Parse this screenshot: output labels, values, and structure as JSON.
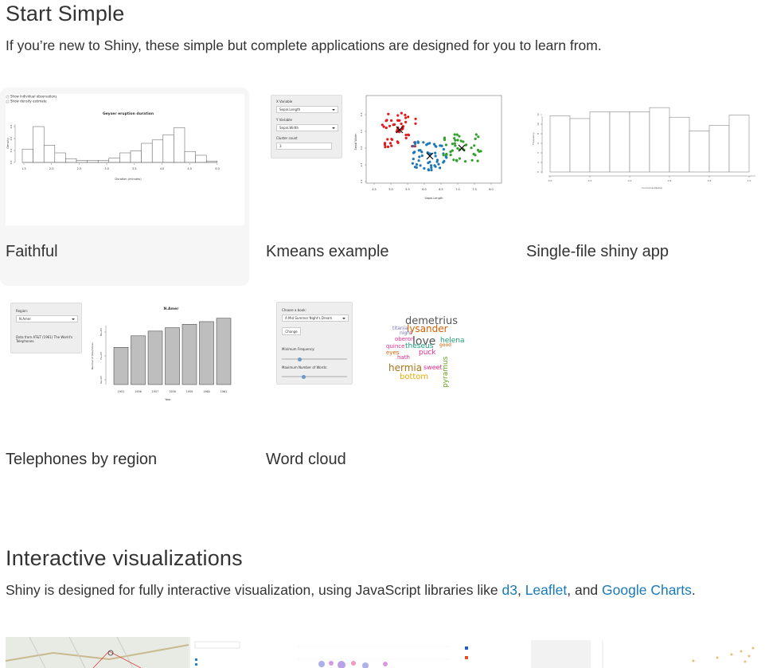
{
  "sections": [
    {
      "title": "Start Simple",
      "description": "If you’re new to Shiny, these simple but complete applications are designed for you to learn from."
    },
    {
      "title": "Interactive visualizations",
      "description_prefix": "Shiny is designed for fully interactive visualization, using JavaScript libraries like ",
      "links": [
        "d3",
        "Leaflet",
        "Google Charts"
      ],
      "sep1": ", ",
      "sep2": ", and ",
      "suffix": "."
    }
  ],
  "cards": [
    {
      "label": "Faithful",
      "thumb": {
        "checkbox1": "Show individual observations",
        "checkbox2": "Show density estimate",
        "title": "Geyser eruption duration",
        "xlabel": "Duration (minutes)",
        "ylabel": "Density",
        "xticks": [
          "1.5",
          "2.0",
          "2.5",
          "3.0",
          "3.5",
          "4.0",
          "4.5",
          "5.0"
        ],
        "yticks": [
          "0.0",
          "0.2",
          "0.4",
          "0.6"
        ],
        "bins": [
          0.28,
          0.75,
          0.36,
          0.2,
          0.08,
          0.04,
          0.04,
          0.04,
          0.09,
          0.2,
          0.24,
          0.4,
          0.47,
          0.58,
          0.73,
          0.23,
          0.15,
          0.03
        ]
      }
    },
    {
      "label": "Kmeans example",
      "thumb": {
        "xvar_label": "X Variable",
        "xvar_value": "Sepal.Length",
        "yvar_label": "Y Variable",
        "yvar_value": "Sepal.Width",
        "count_label": "Cluster count",
        "count_value": "3",
        "xlabel": "Sepal.Length",
        "ylabel": "Sepal.Width",
        "xticks": [
          "4.5",
          "5.0",
          "5.5",
          "6.0",
          "6.5",
          "7.0",
          "7.5",
          "8.0"
        ],
        "yticks": [
          "2.0",
          "2.5",
          "3.0",
          "3.5",
          "4.0"
        ],
        "colors": [
          "#e31a1c",
          "#1f78b4",
          "#33a02c"
        ]
      }
    },
    {
      "label": "Single-file shiny app",
      "thumb": {
        "xlabel": "rnorm(input$obs)",
        "ylabel": "Frequency",
        "xticks": [
          "0.0",
          "0.2",
          "0.4",
          "0.6",
          "0.8",
          "1.0"
        ],
        "yticks": [
          "0",
          "2",
          "4",
          "6",
          "8",
          "10",
          "12"
        ],
        "bins": [
          0.82,
          0.78,
          0.88,
          0.88,
          0.88,
          0.94,
          0.8,
          0.6,
          0.68,
          0.83
        ]
      }
    },
    {
      "label": "Telephones by region",
      "thumb": {
        "region_label": "Region:",
        "region_value": "N.Amer",
        "note": "Data from AT&T (1961) The World's Telephones.",
        "title": "N.Amer",
        "xlabel": "Year",
        "ylabel": "Number of Telephones",
        "years": [
          "1951",
          "1956",
          "1957",
          "1958",
          "1959",
          "1960",
          "1961"
        ],
        "yticks": [
          "6e+07",
          "7e+07",
          "8e+07"
        ],
        "values": [
          0.55,
          0.72,
          0.79,
          0.84,
          0.89,
          0.93,
          0.98
        ]
      }
    },
    {
      "label": "Word cloud",
      "thumb": {
        "book_label": "Choose a book:",
        "book_value": "A Mid Summer Night's Dream",
        "button": "Change",
        "freq_label": "Minimum Frequency:",
        "words_label": "Maximum Number of Words:",
        "words": [
          {
            "t": "demetrius",
            "c": "#555555",
            "s": 13
          },
          {
            "t": "lysander",
            "c": "#d95f02",
            "s": 12
          },
          {
            "t": "titania",
            "c": "#7570b3",
            "s": 6
          },
          {
            "t": "night",
            "c": "#7570b3",
            "s": 6
          },
          {
            "t": "oberon",
            "c": "#e7298a",
            "s": 7
          },
          {
            "t": "love",
            "c": "#555555",
            "s": 14
          },
          {
            "t": "helena",
            "c": "#1b9e77",
            "s": 9
          },
          {
            "t": "quince",
            "c": "#e7298a",
            "s": 7
          },
          {
            "t": "theseus",
            "c": "#1b9e77",
            "s": 9
          },
          {
            "t": "good",
            "c": "#d95f02",
            "s": 6
          },
          {
            "t": "eyes",
            "c": "#d95f02",
            "s": 7
          },
          {
            "t": "puck",
            "c": "#e7298a",
            "s": 9
          },
          {
            "t": "hath",
            "c": "#e7298a",
            "s": 7
          },
          {
            "t": "hermia",
            "c": "#a6761d",
            "s": 12
          },
          {
            "t": "sweet",
            "c": "#e7298a",
            "s": 8
          },
          {
            "t": "bottom",
            "c": "#e6ab02",
            "s": 10
          },
          {
            "t": "pyramus",
            "c": "#66a61e",
            "s": 9
          }
        ]
      }
    }
  ]
}
